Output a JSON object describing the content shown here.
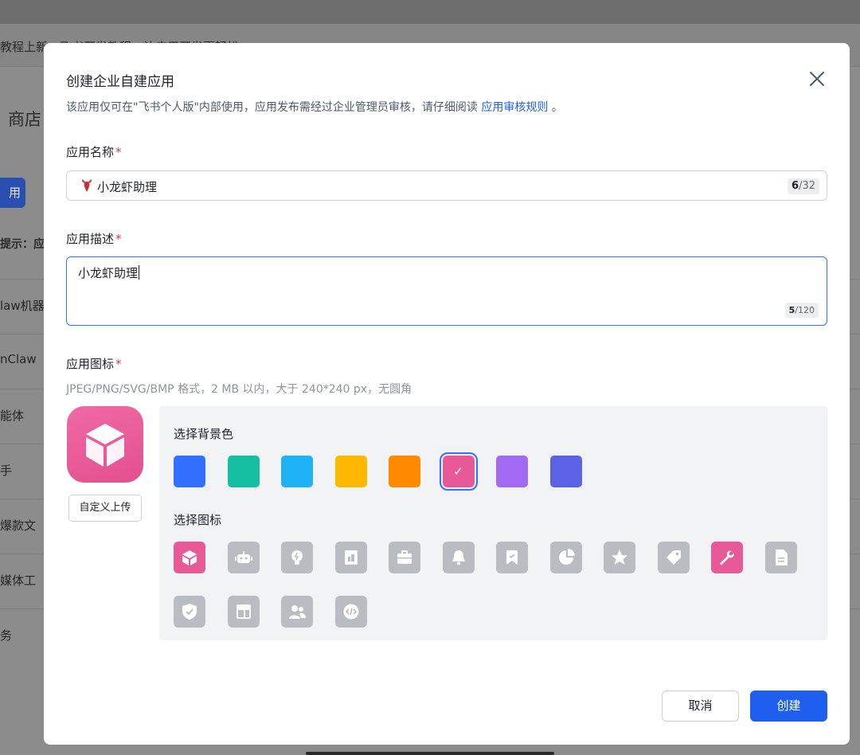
{
  "background": {
    "banner_text": "教程上新：飞书开发教程，让应用开发更轻松",
    "store_label": "商店",
    "button_label": "用",
    "tip_text": "提示：应",
    "rows": [
      "law机器",
      "nClaw",
      "能体",
      "手",
      "爆款文",
      "媒体工",
      "务"
    ]
  },
  "modal": {
    "title": "创建企业自建应用",
    "subtitle_prefix": "该应用仅可在\"飞书个人版\"内部使用，应用发布需经过企业管理员审核，请仔细阅读",
    "subtitle_link": "应用审核规则",
    "subtitle_suffix": "。",
    "name_field": {
      "label": "应用名称",
      "required_mark": "*",
      "value": "小龙虾助理",
      "count": "6",
      "max": "/32"
    },
    "desc_field": {
      "label": "应用描述",
      "required_mark": "*",
      "value": "小龙虾助理",
      "count": "5",
      "max": "/120"
    },
    "icon_field": {
      "label": "应用图标",
      "required_mark": "*",
      "hint": "JPEG/PNG/SVG/BMP 格式，2 MB 以内，大于 240*240 px，无圆角",
      "upload_label": "自定义上传",
      "bg_color_title": "选择背景色",
      "icon_title": "选择图标",
      "colors": [
        "#3370ff",
        "#14c0a0",
        "#1fb2f4",
        "#ffb800",
        "#ff8a00",
        "#e75a97",
        "#a26af3",
        "#5b62e5"
      ],
      "selected_color_index": 5,
      "icons": [
        "cube-icon",
        "robot-icon",
        "bulb-icon",
        "book-icon",
        "briefcase-icon",
        "bell-icon",
        "bookmark-icon",
        "pie-chart-icon",
        "star-icon",
        "tag-icon",
        "wrench-icon",
        "document-icon",
        "shield-icon",
        "layout-icon",
        "users-icon",
        "code-icon"
      ],
      "selected_icon_indices": [
        0,
        10
      ]
    },
    "cancel_label": "取消",
    "create_label": "创建"
  }
}
